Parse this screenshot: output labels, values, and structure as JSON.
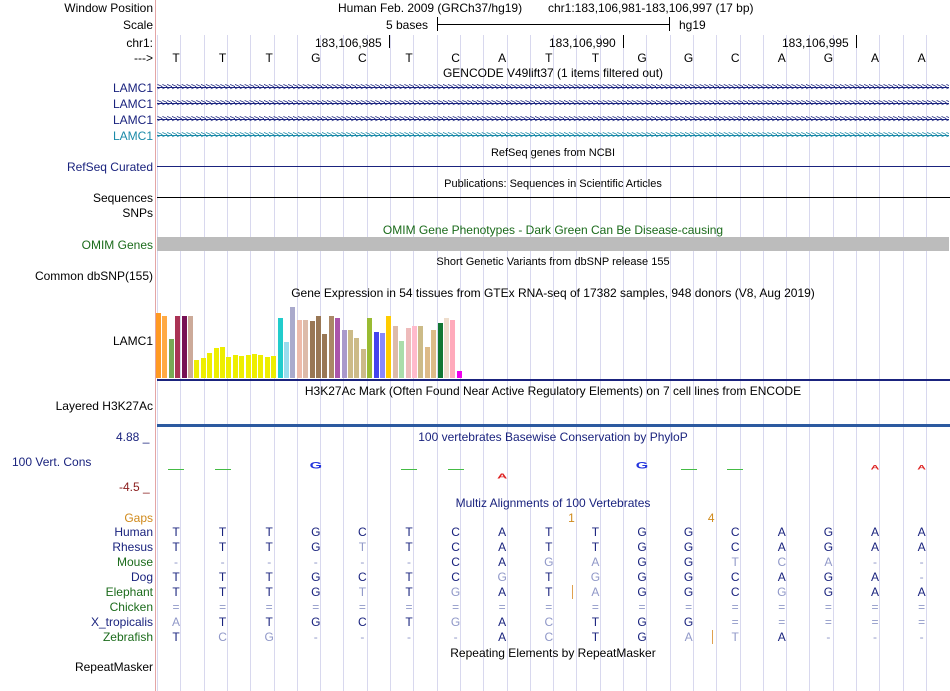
{
  "colors": {
    "navy": "#1a237e",
    "green": "#1b6b1b",
    "orange": "#d08a1c",
    "maroon": "#8a1c1c",
    "teal": "#1a8aa8",
    "gray_base": "#9098c8"
  },
  "header": {
    "window_position_label": "Window Position",
    "scale_label": "Scale",
    "chr_label": "chr1:",
    "arrow_label": "--->",
    "assembly": "Human Feb. 2009 (GRCh37/hg19)",
    "position": "chr1:183,106,981-183,106,997 (17 bp)",
    "scale_text": "5 bases",
    "scale_db": "hg19",
    "ruler": [
      "183,106,985",
      "183,106,990",
      "183,106,995"
    ]
  },
  "sequence": [
    "T",
    "T",
    "T",
    "G",
    "C",
    "T",
    "C",
    "A",
    "T",
    "T",
    "G",
    "G",
    "C",
    "A",
    "G",
    "A",
    "A"
  ],
  "tracks": {
    "gencode": {
      "title": "GENCODE V49lift37 (1 items filtered out)",
      "labels": [
        "LAMC1",
        "LAMC1",
        "LAMC1",
        "LAMC1"
      ]
    },
    "refseq": {
      "label": "RefSeq Curated",
      "title": "RefSeq genes from NCBI"
    },
    "publications": {
      "label": "Sequences",
      "title": "Publications: Sequences in Scientific Articles"
    },
    "snps_label": "SNPs",
    "omim": {
      "label": "OMIM Genes",
      "title": "OMIM Gene Phenotypes - Dark Green Can Be Disease-causing"
    },
    "dbsnp": {
      "label": "Common dbSNP(155)",
      "title": "Short Genetic Variants from dbSNP release 155"
    },
    "gtex": {
      "title": "Gene Expression in 54 tissues from GTEx RNA-seq of 17382 samples, 948 donors (V8, Aug 2019)",
      "label": "LAMC1"
    },
    "h3k27ac": {
      "label": "Layered H3K27Ac",
      "title": "H3K27Ac Mark (Often Found Near Active Regulatory Elements) on 7 cell lines from ENCODE"
    },
    "phylop": {
      "label": "100 Vert. Cons",
      "max": "4.88 _",
      "min": "-4.5 _",
      "title": "100 vertebrates Basewise Conservation by PhyloP"
    },
    "multiz": {
      "title": "Multiz Alignments of 100 Vertebrates",
      "gaps_label": "Gaps",
      "gap_counts": [
        {
          "after_base": 9,
          "value": "1"
        },
        {
          "after_base": 12,
          "value": "4"
        }
      ],
      "species": [
        {
          "name": "Human",
          "bases": [
            "T",
            "T",
            "T",
            "G",
            "C",
            "T",
            "C",
            "A",
            "T",
            "T",
            "G",
            "G",
            "C",
            "A",
            "G",
            "A",
            "A"
          ]
        },
        {
          "name": "Rhesus",
          "bases": [
            "T",
            "T",
            "T",
            "G",
            "T",
            "T",
            "C",
            "A",
            "T",
            "T",
            "G",
            "G",
            "C",
            "A",
            "G",
            "A",
            "A"
          ]
        },
        {
          "name": "Mouse",
          "bases": [
            "-",
            "-",
            "-",
            "-",
            "-",
            "-",
            "C",
            "A",
            "G",
            "A",
            "G",
            "G",
            "T",
            "C",
            "A",
            "-",
            "-"
          ]
        },
        {
          "name": "Dog",
          "bases": [
            "T",
            "T",
            "T",
            "G",
            "C",
            "T",
            "C",
            "G",
            "T",
            "G",
            "G",
            "G",
            "C",
            "A",
            "G",
            "A",
            "-"
          ]
        },
        {
          "name": "Elephant",
          "bases": [
            "T",
            "T",
            "T",
            "G",
            "T",
            "T",
            "G",
            "A",
            "T",
            "A",
            "G",
            "G",
            "C",
            "G",
            "G",
            "A",
            "A"
          ]
        },
        {
          "name": "Chicken",
          "bases": [
            "=",
            "=",
            "=",
            "=",
            "=",
            "=",
            "=",
            "=",
            "=",
            "=",
            "=",
            "=",
            "=",
            "=",
            "=",
            "=",
            "="
          ]
        },
        {
          "name": "X_tropicalis",
          "bases": [
            "A",
            "T",
            "T",
            "G",
            "C",
            "T",
            "G",
            "A",
            "C",
            "T",
            "G",
            "G",
            "=",
            "=",
            "=",
            "=",
            "="
          ]
        },
        {
          "name": "Zebrafish",
          "bases": [
            "T",
            "C",
            "G",
            "-",
            "-",
            "-",
            "-",
            "A",
            "C",
            "T",
            "G",
            "A",
            "T",
            "A",
            "-",
            "-",
            "-"
          ]
        }
      ]
    },
    "repeatmasker": {
      "label": "RepeatMasker",
      "title": "Repeating Elements by RepeatMasker"
    }
  },
  "gtex_bars": [
    {
      "value": 0.91,
      "color": "#ff9922"
    },
    {
      "value": 0.87,
      "color": "#ffaa44"
    },
    {
      "value": 0.55,
      "color": "#77aa55"
    },
    {
      "value": 0.87,
      "color": "#aa3355"
    },
    {
      "value": 0.87,
      "color": "#771155"
    },
    {
      "value": 0.87,
      "color": "#ccaa99"
    },
    {
      "value": 0.25,
      "color": "#eeee00"
    },
    {
      "value": 0.28,
      "color": "#eeee00"
    },
    {
      "value": 0.35,
      "color": "#eeee00"
    },
    {
      "value": 0.42,
      "color": "#eeee00"
    },
    {
      "value": 0.44,
      "color": "#eeee00"
    },
    {
      "value": 0.3,
      "color": "#eeee00"
    },
    {
      "value": 0.32,
      "color": "#eeee00"
    },
    {
      "value": 0.31,
      "color": "#eeee00"
    },
    {
      "value": 0.32,
      "color": "#eeee00"
    },
    {
      "value": 0.34,
      "color": "#eeee00"
    },
    {
      "value": 0.33,
      "color": "#eeee00"
    },
    {
      "value": 0.3,
      "color": "#eeee00"
    },
    {
      "value": 0.31,
      "color": "#eeee00"
    },
    {
      "value": 0.84,
      "color": "#22cccc"
    },
    {
      "value": 0.51,
      "color": "#99ddee"
    },
    {
      "value": 1.0,
      "color": "#aaaacc"
    },
    {
      "value": 0.82,
      "color": "#eebbaa"
    },
    {
      "value": 0.81,
      "color": "#ddbbaa"
    },
    {
      "value": 0.8,
      "color": "#997755"
    },
    {
      "value": 0.88,
      "color": "#997755"
    },
    {
      "value": 0.62,
      "color": "#997755"
    },
    {
      "value": 0.87,
      "color": "#aa8866"
    },
    {
      "value": 0.84,
      "color": "#aa55aa"
    },
    {
      "value": 0.68,
      "color": "#aa99cc"
    },
    {
      "value": 0.67,
      "color": "#ccbb88"
    },
    {
      "value": 0.56,
      "color": "#ccbb88"
    },
    {
      "value": 0.41,
      "color": "#ccbb88"
    },
    {
      "value": 0.84,
      "color": "#99bb33"
    },
    {
      "value": 0.65,
      "color": "#4444ee"
    },
    {
      "value": 0.63,
      "color": "#8888ff"
    },
    {
      "value": 0.87,
      "color": "#ffcc00"
    },
    {
      "value": 0.73,
      "color": "#ddbbaa"
    },
    {
      "value": 0.52,
      "color": "#aaddaa"
    },
    {
      "value": 0.7,
      "color": "#eebbbb"
    },
    {
      "value": 0.73,
      "color": "#ffbbcc"
    },
    {
      "value": 0.73,
      "color": "#ccbb88"
    },
    {
      "value": 0.44,
      "color": "#ddbb88"
    },
    {
      "value": 0.67,
      "color": "#ddbb88"
    },
    {
      "value": 0.78,
      "color": "#117733"
    },
    {
      "value": 0.84,
      "color": "#eeddcc"
    },
    {
      "value": 0.82,
      "color": "#ffaabb"
    },
    {
      "value": 0.1,
      "color": "#ee00ee"
    }
  ],
  "phylop_letters": [
    {
      "base": "G",
      "color": "#2233dd",
      "score": 0.55
    },
    {
      "base": "A",
      "color": "#dd2222",
      "score": -0.45
    },
    {
      "base": "G",
      "color": "#2233dd",
      "score": 0.55
    },
    {
      "base": "A",
      "color": "#dd2222",
      "score": 0.2
    },
    {
      "base": "A",
      "color": "#dd2222",
      "score": 0.2
    }
  ]
}
